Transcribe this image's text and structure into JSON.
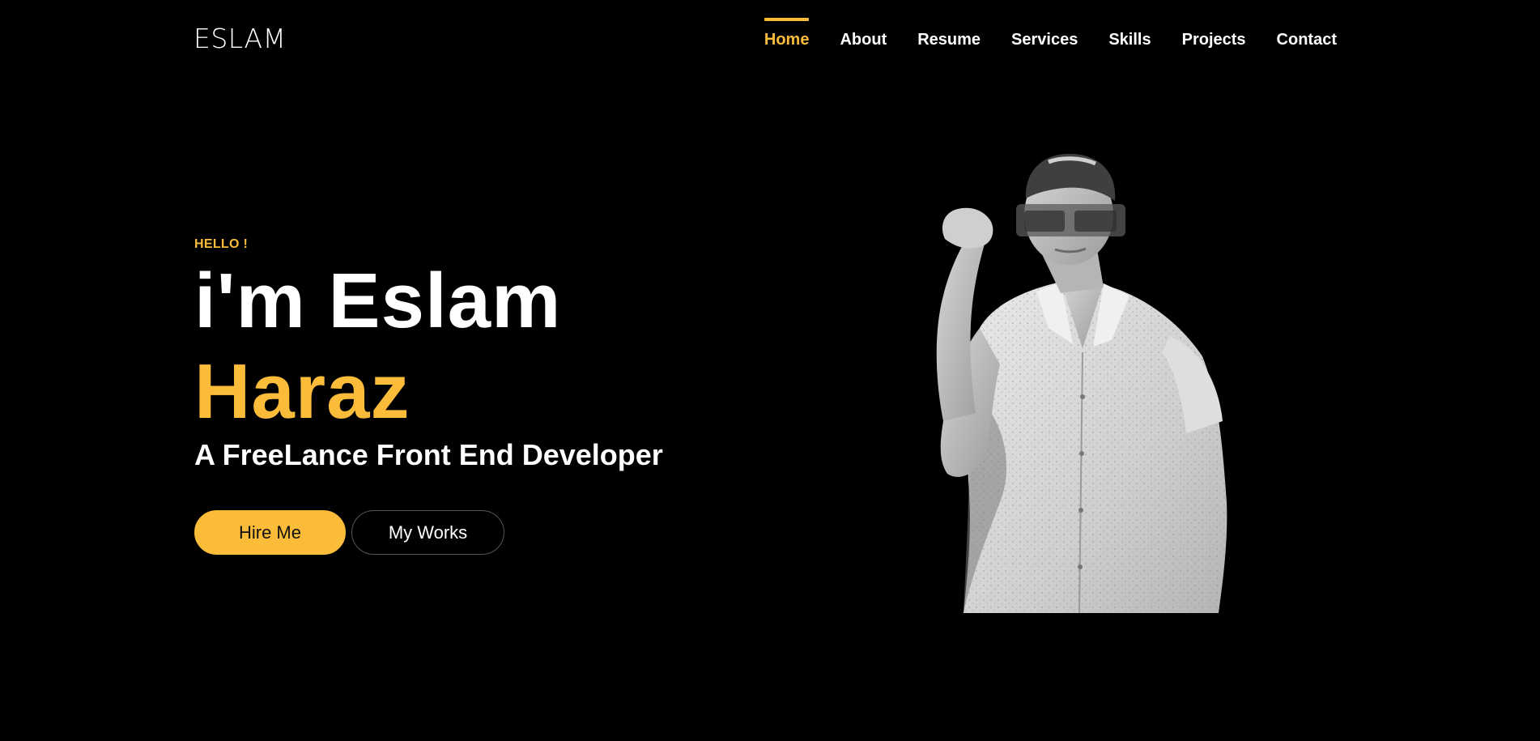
{
  "header": {
    "logo": "ESLAM",
    "nav": [
      {
        "label": "Home",
        "active": true
      },
      {
        "label": "About",
        "active": false
      },
      {
        "label": "Resume",
        "active": false
      },
      {
        "label": "Services",
        "active": false
      },
      {
        "label": "Skills",
        "active": false
      },
      {
        "label": "Projects",
        "active": false
      },
      {
        "label": "Contact",
        "active": false
      }
    ]
  },
  "hero": {
    "greeting": "HELLO !",
    "name_line_1": "i'm Eslam",
    "name_line_2": "Haraz",
    "role": "A FreeLance Front End Developer",
    "buttons": {
      "primary": "Hire Me",
      "secondary": "My Works"
    },
    "portrait_icon": "person-photo"
  },
  "colors": {
    "background": "#000000",
    "accent": "#fbbc3a",
    "text": "#ffffff"
  }
}
